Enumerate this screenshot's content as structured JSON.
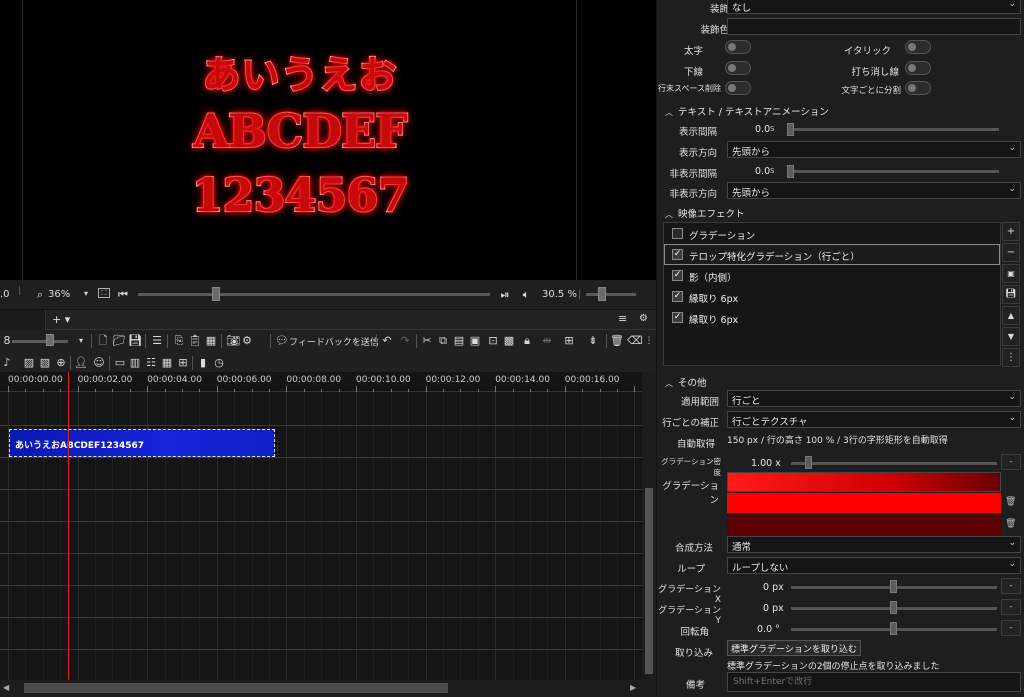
{
  "preview": {
    "lines": [
      "あいうえお",
      "ABCDEF",
      "1234567"
    ],
    "zoom_value": "36%",
    "left_value": ".0",
    "speed": "30.5 %"
  },
  "timeline": {
    "ruler_labels": [
      "00:00:00.00",
      "00:00:02.00",
      "00:00:04.00",
      "00:00:06.00",
      "00:00:08.00",
      "00:00:10.00",
      "00:00:12.00",
      "00:00:14.00",
      "00:00:16.00"
    ],
    "clip_label": "あいうえおABCDEF1234567",
    "feedback_label": "フィードバックを送信",
    "tab_add": "+ ▾",
    "row_prefix": "8"
  },
  "props": {
    "decoration": {
      "label": "装飾",
      "value": "なし"
    },
    "decoration_color": {
      "label": "装飾色"
    },
    "toggles": [
      {
        "label": "太字"
      },
      {
        "label": "イタリック"
      },
      {
        "label": "下線"
      },
      {
        "label": "打ち消し線"
      },
      {
        "label": "行末スペース削除"
      },
      {
        "label": "文字ごとに分割"
      }
    ],
    "text_anim_section": "テキスト / テキストアニメーション",
    "display_interval": {
      "label": "表示間隔",
      "value": "0.0",
      "unit": "s"
    },
    "display_direction": {
      "label": "表示方向",
      "value": "先頭から"
    },
    "hide_interval": {
      "label": "非表示間隔",
      "value": "0.0",
      "unit": "s"
    },
    "hide_direction": {
      "label": "非表示方向",
      "value": "先頭から"
    },
    "video_effects_section": "映像エフェクト",
    "effects": [
      {
        "label": "グラデーション",
        "checked": false
      },
      {
        "label": "テロップ特化グラデーション（行ごと）",
        "checked": true
      },
      {
        "label": "影（内側）",
        "checked": true
      },
      {
        "label": "縁取り 6px",
        "checked": true
      },
      {
        "label": "縁取り 6px",
        "checked": true
      }
    ],
    "other_section": "その他",
    "apply_range": {
      "label": "適用範囲",
      "value": "行ごと"
    },
    "line_correction": {
      "label": "行ごとの補正",
      "value": "行ごとテクスチャ"
    },
    "auto_get": {
      "label": "自動取得",
      "value": "150 px / 行の高さ 100 % / 3行の字形矩形を自動取得"
    },
    "gradient_density": {
      "label": "グラデーション密度",
      "value": "1.00 x"
    },
    "gradient": {
      "label": "グラデーション"
    },
    "blend": {
      "label": "合成方法",
      "value": "通常"
    },
    "loop": {
      "label": "ループ",
      "value": "ループしない"
    },
    "grad_x": {
      "label": "グラデーションX",
      "value": "0 px"
    },
    "grad_y": {
      "label": "グラデーションY",
      "value": "0 px"
    },
    "rotation": {
      "label": "回転角",
      "value": "0.0 °"
    },
    "import": {
      "label": "取り込み",
      "button": "標準グラデーションを取り込む",
      "message": "標準グラデーションの2個の停止点を取り込みました"
    },
    "memo": {
      "label": "備考",
      "placeholder": "Shift+Enterで改行"
    }
  },
  "colors": {
    "clip": "#1724d8",
    "playhead": "#e02020",
    "gradient_top": "#ff0000",
    "gradient_bottom": "#5a0000"
  }
}
